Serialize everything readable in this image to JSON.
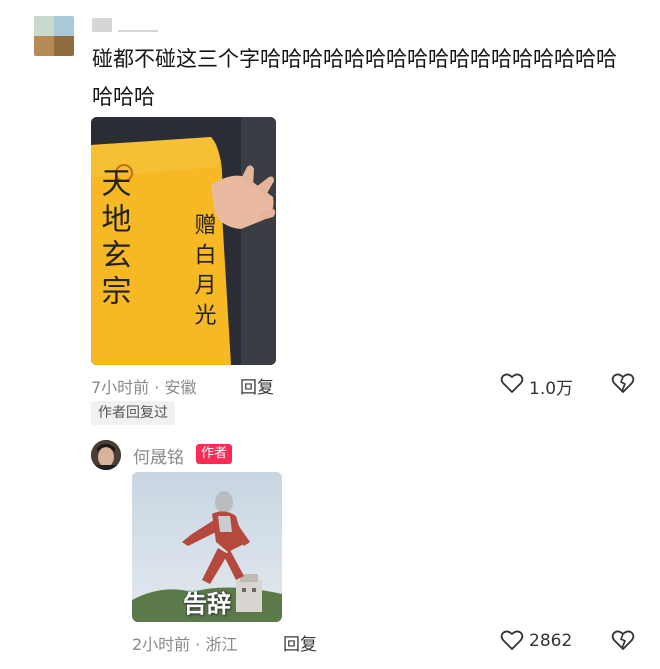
{
  "comment": {
    "text": "碰都不碰这三个字哈哈哈哈哈哈哈哈哈哈哈哈哈哈哈哈哈哈哈哈",
    "time_location": "7小时前 · 安徽",
    "reply_label": "回复",
    "likes": "1.0万",
    "author_replied_tag": "作者回复过",
    "image_text": [
      "天地玄宗",
      "赠白月光"
    ]
  },
  "reply": {
    "author_name": "何晟铭",
    "author_badge": "作者",
    "image_caption": "告辞",
    "time_location": "2小时前 · 浙江",
    "reply_label": "回复",
    "likes": "2862"
  },
  "colors": {
    "badge": "#fe2c55",
    "meta_text": "#8a8a8a",
    "paper_yellow": "#f7b923"
  },
  "icons": [
    "heart-icon",
    "broken-heart-icon"
  ]
}
